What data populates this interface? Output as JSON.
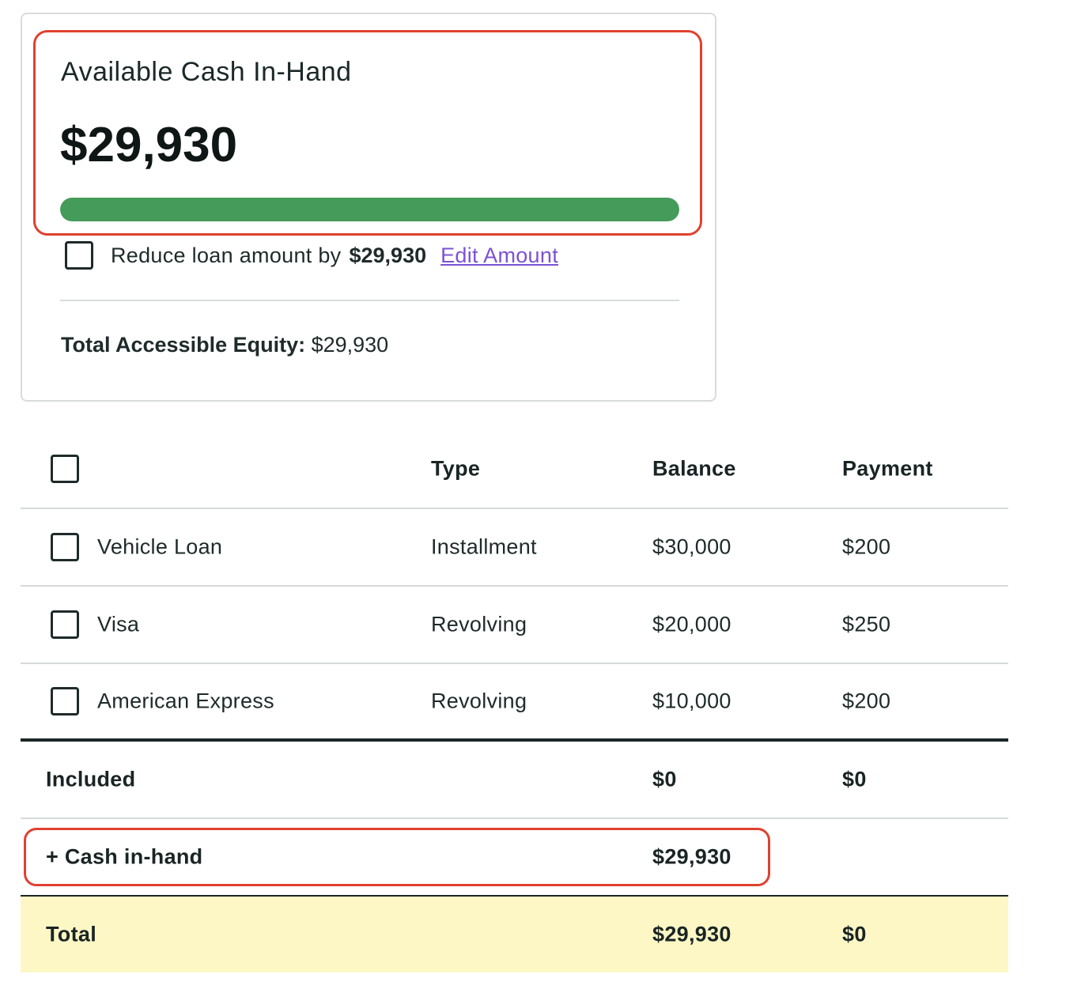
{
  "card": {
    "title": "Available Cash In-Hand",
    "amount": "$29,930",
    "progress_fraction": 1.0,
    "progress_color": "#459b59",
    "reduce_label": "Reduce loan amount by",
    "reduce_amount": "$29,930",
    "edit_link": "Edit Amount",
    "equity_label": "Total Accessible Equity:",
    "equity_value": "$29,930"
  },
  "table": {
    "headers": {
      "type": "Type",
      "balance": "Balance",
      "payment": "Payment"
    },
    "rows": [
      {
        "name": "Vehicle Loan",
        "type": "Installment",
        "balance": "$30,000",
        "payment": "$200"
      },
      {
        "name": "Visa",
        "type": "Revolving",
        "balance": "$20,000",
        "payment": "$250"
      },
      {
        "name": "American Express",
        "type": "Revolving",
        "balance": "$10,000",
        "payment": "$200"
      }
    ],
    "included": {
      "label": "Included",
      "balance": "$0",
      "payment": "$0"
    },
    "cash_in_hand": {
      "label": "+ Cash in-hand",
      "balance": "$29,930"
    },
    "total": {
      "label": "Total",
      "balance": "$29,930",
      "payment": "$0"
    }
  },
  "colors": {
    "highlight": "#e0412f",
    "link": "#7b52d6",
    "total_row_bg": "#fdf7c6"
  }
}
